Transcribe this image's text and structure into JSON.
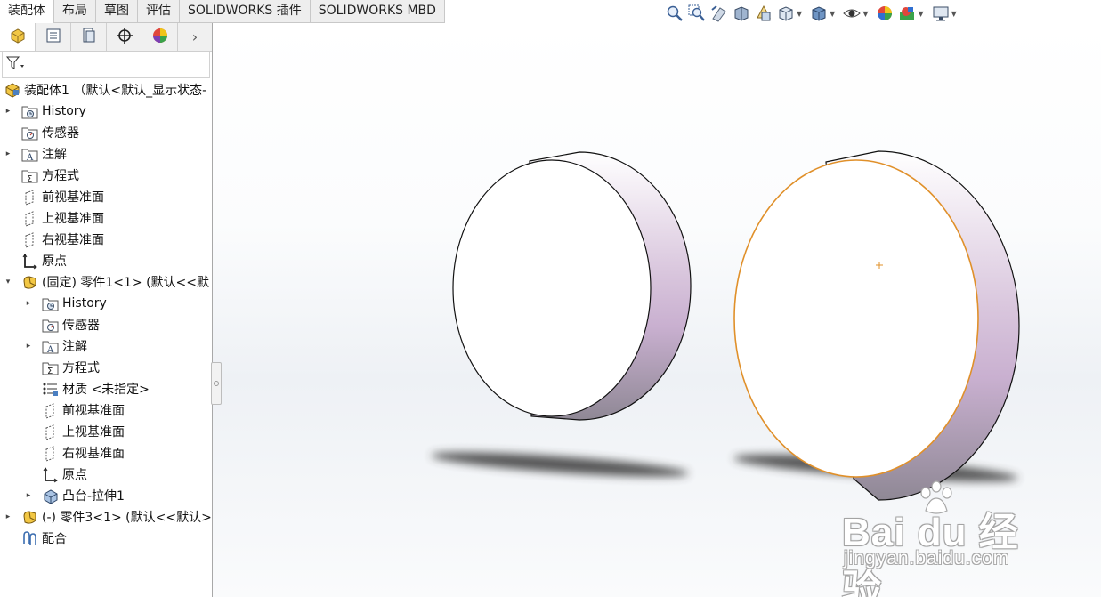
{
  "command_tabs": [
    "装配体",
    "布局",
    "草图",
    "评估",
    "SOLIDWORKS 插件",
    "SOLIDWORKS MBD"
  ],
  "active_tab": "装配体",
  "view_toolbar": {
    "icons": [
      "zoom-to-fit-icon",
      "zoom-to-area-icon",
      "previous-view-icon",
      "section-view-icon",
      "dynamic-annotation-icon",
      "view-orientation-icon",
      "display-style-icon",
      "hide-show-items-icon",
      "edit-appearance-icon",
      "apply-scene-icon",
      "view-settings-icon"
    ]
  },
  "panel_tabs": [
    "feature-manager-icon",
    "property-manager-icon",
    "configuration-manager-icon",
    "dimxpert-icon",
    "display-manager-icon"
  ],
  "tree": {
    "root": "装配体1 （默认<默认_显示状态-",
    "items": [
      {
        "label": "History",
        "icon": "history-folder-icon",
        "expandable": true
      },
      {
        "label": "传感器",
        "icon": "sensor-folder-icon",
        "expandable": false
      },
      {
        "label": "注解",
        "icon": "annotation-folder-icon",
        "expandable": true
      },
      {
        "label": "方程式",
        "icon": "equation-folder-icon",
        "expandable": false
      },
      {
        "label": "前视基准面",
        "icon": "plane-icon",
        "expandable": false
      },
      {
        "label": "上视基准面",
        "icon": "plane-icon",
        "expandable": false
      },
      {
        "label": "右视基准面",
        "icon": "plane-icon",
        "expandable": false
      },
      {
        "label": "原点",
        "icon": "origin-icon",
        "expandable": false
      },
      {
        "label": "(固定) 零件1<1> (默认<<默",
        "icon": "part-icon",
        "expandable": true,
        "expanded": true
      }
    ],
    "part1_children": [
      {
        "label": "History",
        "icon": "history-folder-icon",
        "expandable": true
      },
      {
        "label": "传感器",
        "icon": "sensor-folder-icon",
        "expandable": false
      },
      {
        "label": "注解",
        "icon": "annotation-folder-icon",
        "expandable": true
      },
      {
        "label": "方程式",
        "icon": "equation-folder-icon",
        "expandable": false
      },
      {
        "label": "材质 <未指定>",
        "icon": "material-icon",
        "expandable": false
      },
      {
        "label": "前视基准面",
        "icon": "plane-icon",
        "expandable": false
      },
      {
        "label": "上视基准面",
        "icon": "plane-icon",
        "expandable": false
      },
      {
        "label": "右视基准面",
        "icon": "plane-icon",
        "expandable": false
      },
      {
        "label": "原点",
        "icon": "origin-icon",
        "expandable": false
      },
      {
        "label": "凸台-拉伸1",
        "icon": "extrude-icon",
        "expandable": true
      }
    ],
    "after": [
      {
        "label": "(-) 零件3<1> (默认<<默认>",
        "icon": "part-icon",
        "expandable": true
      },
      {
        "label": "配合",
        "icon": "mates-icon",
        "expandable": false
      }
    ]
  },
  "watermark": {
    "logo": "Bai du 经验",
    "url": "jingyan.baidu.com"
  },
  "colors": {
    "selection_edge": "#e0902a",
    "cylinder_side": "#c9b4cf",
    "accent": "#1f5ca8"
  }
}
